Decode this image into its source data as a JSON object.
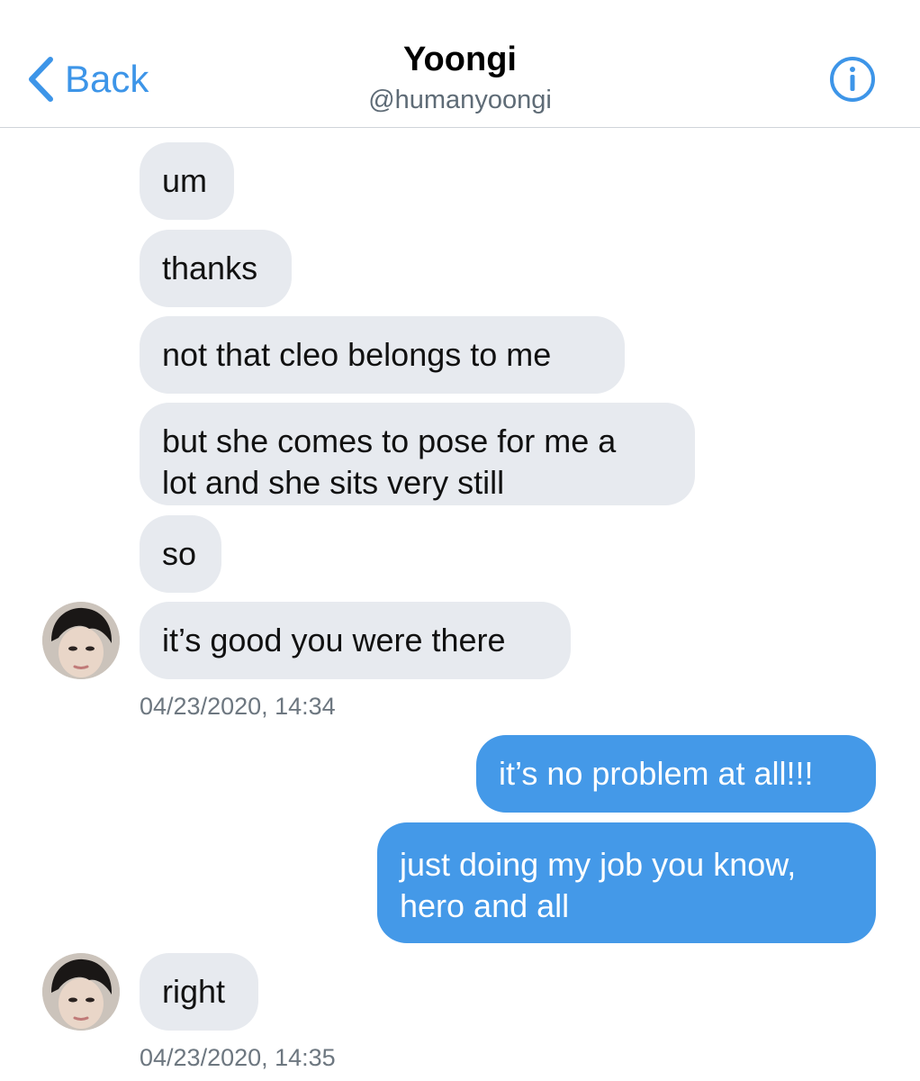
{
  "header": {
    "back_label": "Back",
    "name": "Yoongi",
    "handle": "@humanyoongi"
  },
  "messages": {
    "m1": "um",
    "m2": "thanks",
    "m3": "not that cleo belongs to me",
    "m4_line1": "but she comes to pose for me a",
    "m4_line2": "lot and she sits very still",
    "m5": "so",
    "m6": "it’s good you were there",
    "ts1": "04/23/2020, 14:34",
    "m7": "it’s no problem at all!!!",
    "m8_line1": "just doing my job you know,",
    "m8_line2": "hero and all",
    "m9": "right",
    "ts2": "04/23/2020, 14:35"
  },
  "colors": {
    "accent": "#3d95e8",
    "incoming_bubble": "#e7eaef",
    "outgoing_bubble": "#4499e8"
  }
}
